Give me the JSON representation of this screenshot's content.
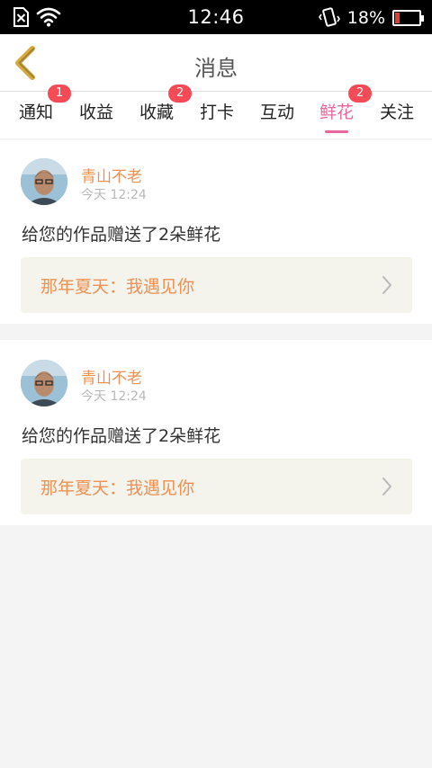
{
  "status_bar": {
    "time": "12:46",
    "battery_percent": "18%",
    "battery_level": 0.18,
    "icons": [
      "no-sim-icon",
      "wifi-icon",
      "vibrate-icon",
      "battery-icon"
    ]
  },
  "header": {
    "title": "消息",
    "back_icon": "chevron-left-icon"
  },
  "tabs": [
    {
      "label": "通知",
      "badge": "1"
    },
    {
      "label": "收益",
      "badge": null
    },
    {
      "label": "收藏",
      "badge": "2"
    },
    {
      "label": "打卡",
      "badge": null
    },
    {
      "label": "互动",
      "badge": null
    },
    {
      "label": "鲜花",
      "badge": "2",
      "active": true
    },
    {
      "label": "关注",
      "badge": null
    }
  ],
  "messages": [
    {
      "user": "青山不老",
      "time": "今天 12:24",
      "text": "给您的作品赠送了2朵鲜花",
      "work_title": "那年夏天：我遇见你"
    },
    {
      "user": "青山不老",
      "time": "今天 12:24",
      "text": "给您的作品赠送了2朵鲜花",
      "work_title": "那年夏天：我遇见你"
    }
  ],
  "colors": {
    "accent": "#e8679c",
    "name": "#ee9152",
    "badge": "#f44b56",
    "back_arrow": "#d9a93a"
  }
}
